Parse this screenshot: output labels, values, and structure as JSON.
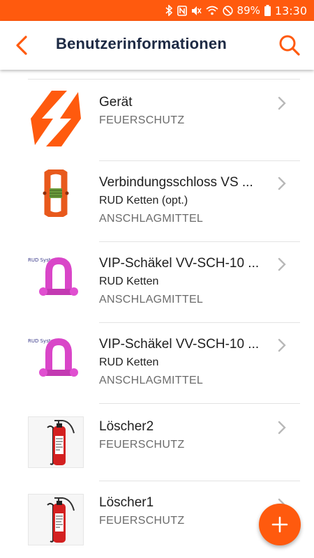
{
  "status_bar": {
    "battery": "89%",
    "time": "13:30",
    "icons": [
      "bluetooth-icon",
      "nfc-icon",
      "mute-icon",
      "wifi-icon",
      "do-not-disturb-icon",
      "battery-icon"
    ]
  },
  "app_bar": {
    "title": "Benutzerinformationen",
    "back_icon": "back-arrow-icon",
    "search_icon": "search-icon"
  },
  "accent_color": "#ff5a0e",
  "items": [
    {
      "name": "Gerät",
      "subtitle": "",
      "category": "FEUERSCHUTZ",
      "thumbnail": "logo-icon"
    },
    {
      "name": "Verbindungsschloss VS ...",
      "subtitle": "RUD Ketten (opt.)",
      "category": "ANSCHLAGMITTEL",
      "thumbnail": "connector-link-icon"
    },
    {
      "name": "VIP-Schäkel VV-SCH-10 ...",
      "subtitle": "RUD Ketten",
      "category": "ANSCHLAGMITTEL",
      "thumbnail": "shackle-icon",
      "thumb_caption": "RUD System"
    },
    {
      "name": "VIP-Schäkel VV-SCH-10 ...",
      "subtitle": "RUD Ketten",
      "category": "ANSCHLAGMITTEL",
      "thumbnail": "shackle-icon",
      "thumb_caption": "RUD System"
    },
    {
      "name": "Löscher2",
      "subtitle": "",
      "category": "FEUERSCHUTZ",
      "thumbnail": "fire-extinguisher-icon"
    },
    {
      "name": "Löscher1",
      "subtitle": "",
      "category": "FEUERSCHUTZ",
      "thumbnail": "fire-extinguisher-icon"
    }
  ],
  "fab": {
    "icon": "plus-icon"
  }
}
